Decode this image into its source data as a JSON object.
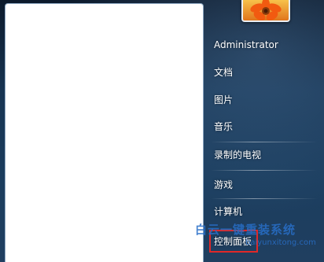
{
  "user": {
    "name": "Administrator",
    "picture_icon": "flower-avatar"
  },
  "right_pane": {
    "items": [
      {
        "label": "文档"
      },
      {
        "label": "图片"
      },
      {
        "label": "音乐"
      },
      {
        "label": "录制的电视"
      },
      {
        "label": "游戏"
      },
      {
        "label": "计算机"
      },
      {
        "label": "控制面板"
      }
    ]
  },
  "watermark": {
    "title": "白云一键重装系统",
    "url": "baiyunxitong.com"
  },
  "colors": {
    "highlight": "#e02828",
    "menu_bg": "#173452"
  }
}
